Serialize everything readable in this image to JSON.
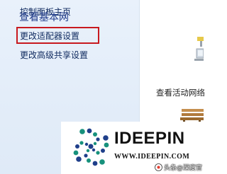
{
  "sidebar": {
    "links": [
      {
        "label": "控制面板主页"
      },
      {
        "label": "更改适配器设置"
      },
      {
        "label": "更改高级共享设置"
      }
    ]
  },
  "content": {
    "title": "查看基本网",
    "active_networks_label": "查看活动网络"
  },
  "banner": {
    "brand_name": "IDEEPIN",
    "url": "WWW.IDEEPIN.COM",
    "watermark": "头条@深度官"
  },
  "colors": {
    "highlight_border": "#c8191f",
    "link_text": "#0f2a5f",
    "title_text": "#1e3a8a",
    "sidebar_bg": "#e4eef9",
    "logo_blue": "#1f3f8a",
    "logo_green": "#17917c"
  }
}
